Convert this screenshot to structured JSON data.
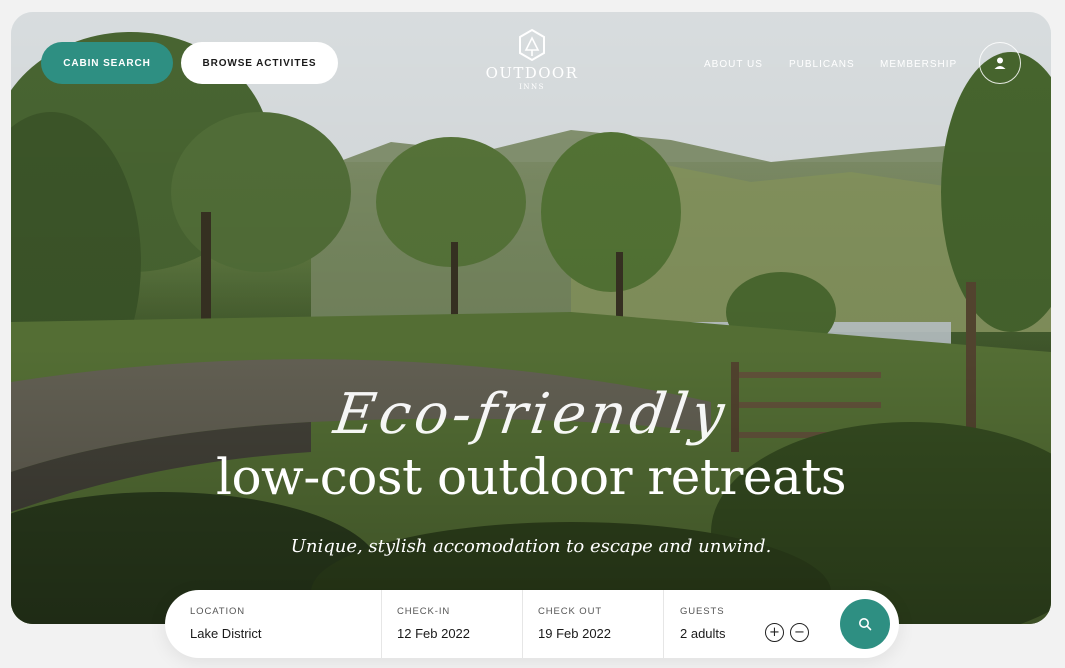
{
  "header": {
    "cabin_search_label": "CABIN SEARCH",
    "browse_label": "BROWSE ACTIVITES",
    "logo_name": "OUTDOOR",
    "logo_sub": "INNS",
    "nav": [
      {
        "label": "ABOUT US"
      },
      {
        "label": "PUBLICANS"
      },
      {
        "label": "MEMBERSHIP"
      }
    ],
    "avatar_icon": "user-icon"
  },
  "hero": {
    "script_title": "Eco-friendly",
    "headline": "low-cost outdoor retreats",
    "subline": "Unique, stylish accomodation to escape and unwind."
  },
  "search": {
    "location_label": "LOCATION",
    "location_value": "Lake District",
    "checkin_label": "CHECK-IN",
    "checkin_value": "12 Feb 2022",
    "checkout_label": "CHECK OUT",
    "checkout_value": "19 Feb 2022",
    "guests_label": "GUESTS",
    "guests_value": "2 adults",
    "plus_icon": "plus-icon",
    "minus_icon": "minus-icon",
    "search_icon": "search-icon"
  },
  "colors": {
    "accent": "#2e8f82",
    "white": "#ffffff",
    "text": "#1a1a1a"
  }
}
